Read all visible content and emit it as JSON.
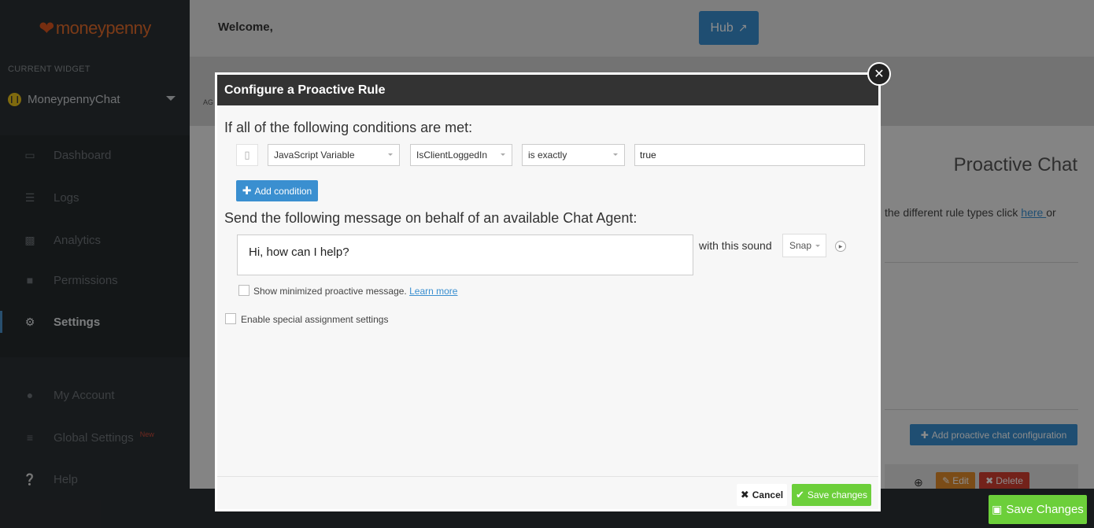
{
  "sidebar": {
    "brand": "moneypenny",
    "current_widget_label": "CURRENT WIDGET",
    "widget_name": "MoneypennyChat",
    "items": [
      {
        "label": "Dashboard",
        "icon": "monitor-icon"
      },
      {
        "label": "Logs",
        "icon": "list-icon"
      },
      {
        "label": "Analytics",
        "icon": "bar-chart-icon"
      },
      {
        "label": "Permissions",
        "icon": "lock-icon"
      },
      {
        "label": "Settings",
        "icon": "gear-icon"
      },
      {
        "label": "My Account",
        "icon": "user-icon"
      },
      {
        "label": "Global Settings",
        "icon": "sliders-icon"
      },
      {
        "label": "Help",
        "icon": "help-icon"
      }
    ],
    "new_badge": "New"
  },
  "header": {
    "welcome": "Welcome,",
    "hub_label": "Hub"
  },
  "subbar": {
    "prefix": "AG"
  },
  "background": {
    "page_title": "Proactive Chat",
    "rule_text": "the different rule types click ",
    "rule_link": "here ",
    "rule_tail": "or",
    "add_config_label": "Add proactive chat configuration",
    "edit_label": "Edit",
    "delete_label": "Delete",
    "save_changes_label": "Save Changes"
  },
  "modal": {
    "title": "Configure a Proactive Rule",
    "conditions_heading": "If all of the following conditions are met:",
    "condition": {
      "type": "JavaScript Variable",
      "variable": "IsClientLoggedIn",
      "operator": "is exactly",
      "value": "true"
    },
    "add_condition_label": "Add condition",
    "message_heading": "Send the following message on behalf of an available Chat Agent:",
    "message": "Hi, how can I help?",
    "sound_label": "with this sound",
    "sound_value": "Snap",
    "show_minimized_label": "Show minimized proactive message.",
    "learn_more_label": "Learn more",
    "special_assignment_label": "Enable special assignment settings",
    "cancel_label": "Cancel",
    "save_label": "Save changes"
  },
  "colors": {
    "accent": "#3a8fd0",
    "success": "#6ccf3a",
    "danger": "#d23f31",
    "warning": "#e08a2b",
    "brand": "#e06a2b"
  }
}
